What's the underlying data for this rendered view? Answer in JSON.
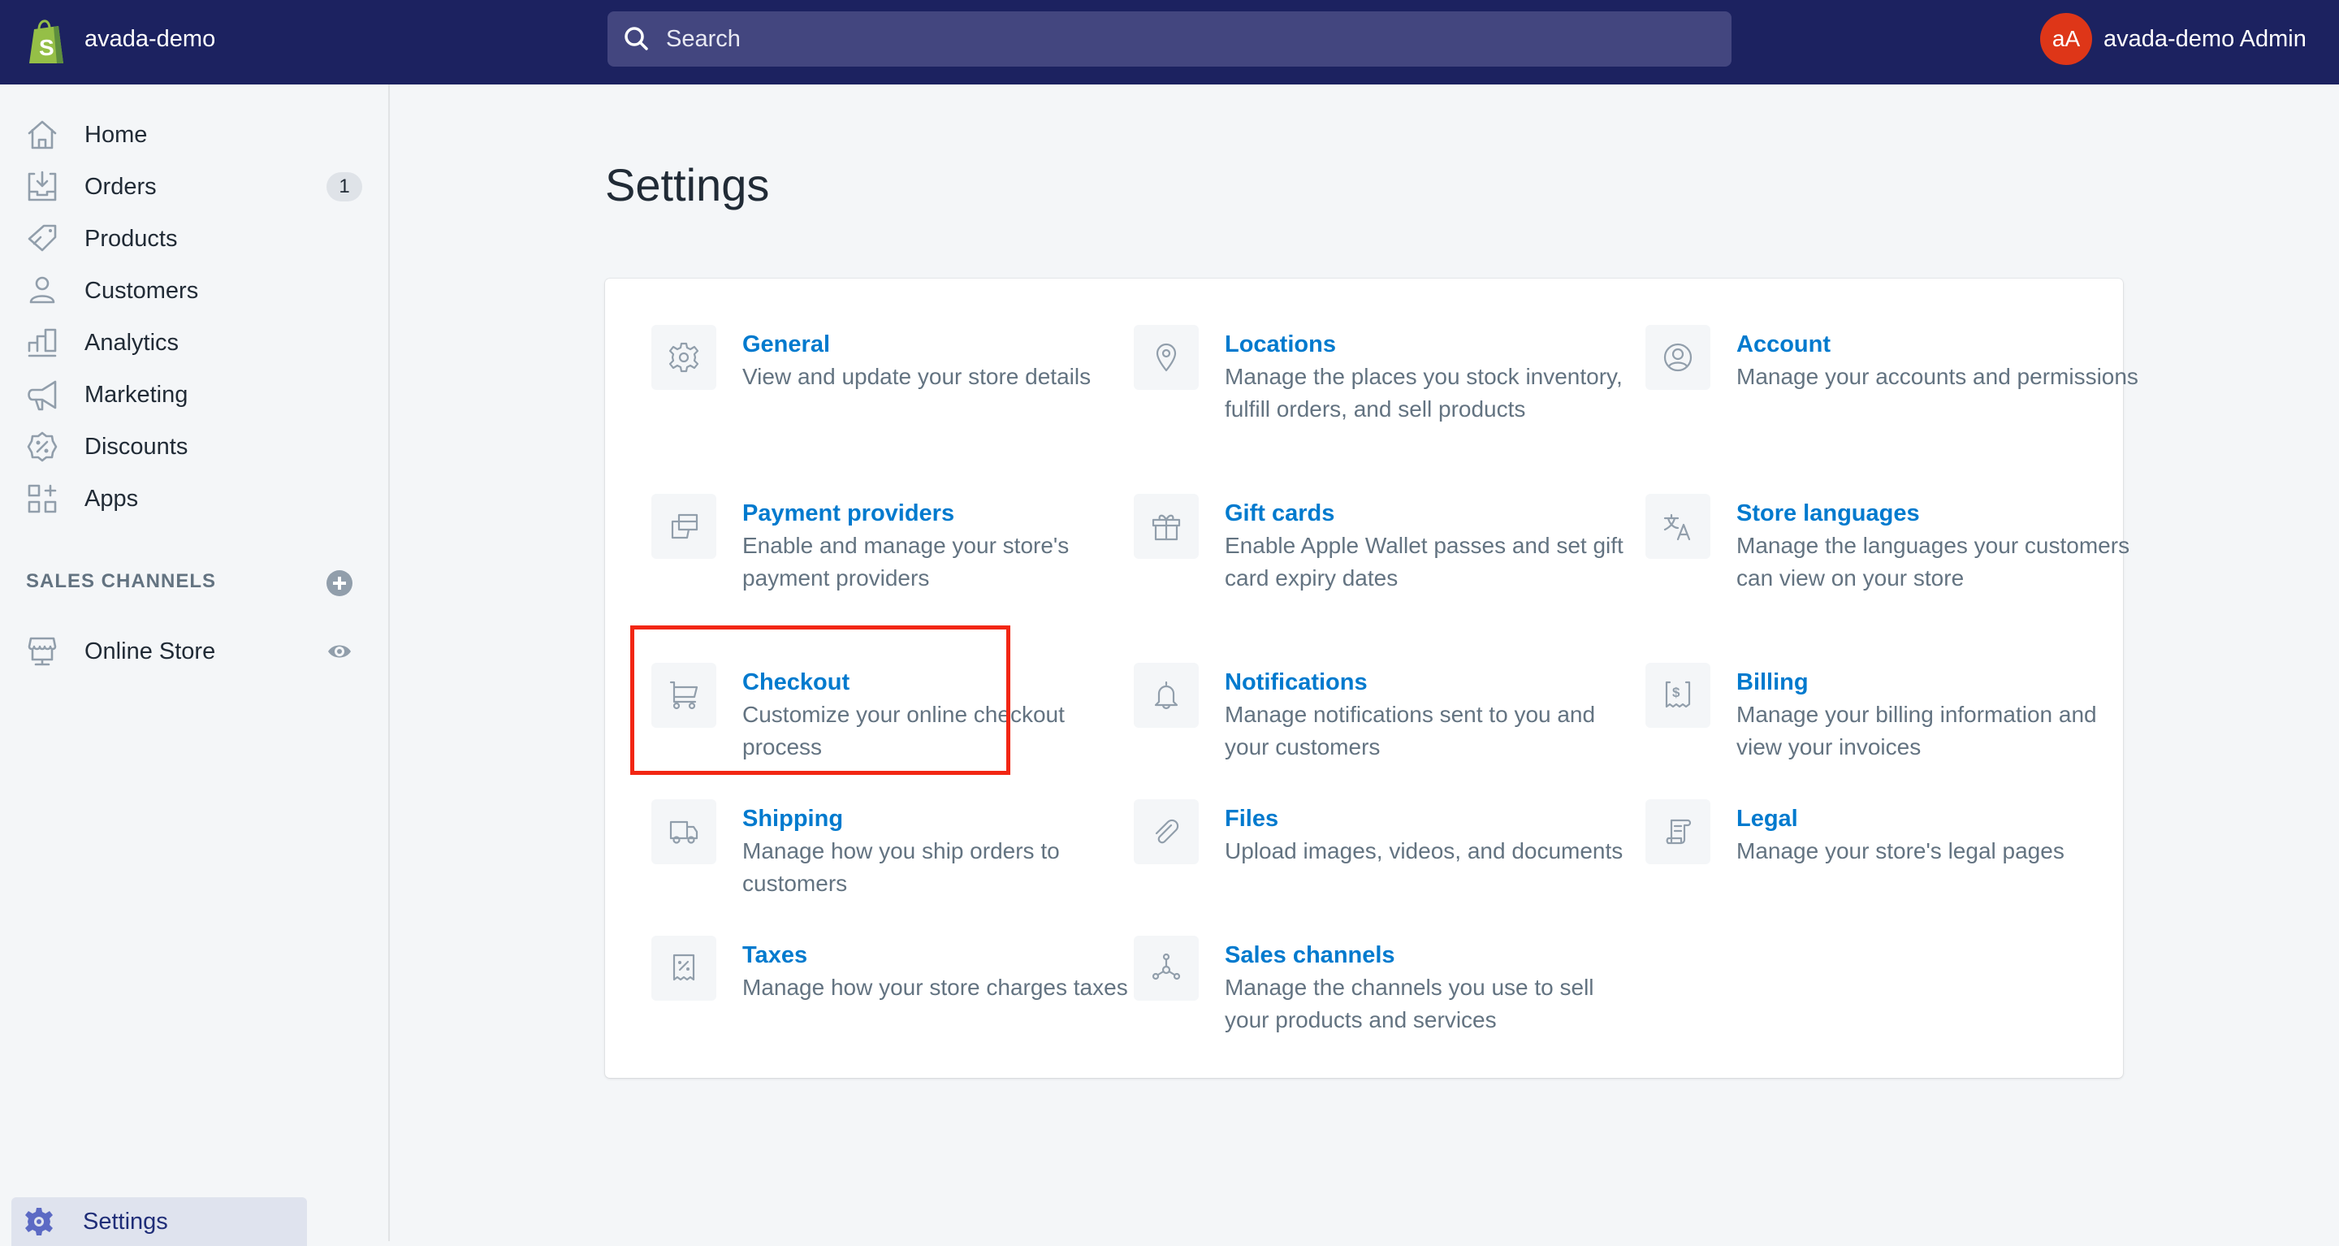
{
  "topbar": {
    "store_name": "avada-demo",
    "search_placeholder": "Search",
    "avatar_initials": "aA",
    "user_name": "avada-demo Admin"
  },
  "sidebar": {
    "items": [
      {
        "label": "Home",
        "icon": "home-icon"
      },
      {
        "label": "Orders",
        "icon": "orders-icon",
        "badge": "1"
      },
      {
        "label": "Products",
        "icon": "tag-icon"
      },
      {
        "label": "Customers",
        "icon": "person-icon"
      },
      {
        "label": "Analytics",
        "icon": "bar-chart-icon"
      },
      {
        "label": "Marketing",
        "icon": "megaphone-icon"
      },
      {
        "label": "Discounts",
        "icon": "discount-icon"
      },
      {
        "label": "Apps",
        "icon": "apps-icon"
      }
    ],
    "sales_channels_heading": "SALES CHANNELS",
    "channels": [
      {
        "label": "Online Store",
        "icon": "store-icon"
      }
    ],
    "settings_label": "Settings"
  },
  "main": {
    "title": "Settings",
    "settings": [
      {
        "title": "General",
        "desc": "View and update your store details",
        "icon": "gear-icon"
      },
      {
        "title": "Locations",
        "desc": "Manage the places you stock inventory, fulfill orders, and sell products",
        "icon": "location-pin-icon"
      },
      {
        "title": "Account",
        "desc": "Manage your accounts and permissions",
        "icon": "account-icon"
      },
      {
        "title": "Payment providers",
        "desc": "Enable and manage your store's payment providers",
        "icon": "payment-icon"
      },
      {
        "title": "Gift cards",
        "desc": "Enable Apple Wallet passes and set gift card expiry dates",
        "icon": "gift-icon"
      },
      {
        "title": "Store languages",
        "desc": "Manage the languages your customers can view on your store",
        "icon": "translate-icon"
      },
      {
        "title": "Checkout",
        "desc": "Customize your online checkout process",
        "icon": "cart-icon"
      },
      {
        "title": "Notifications",
        "desc": "Manage notifications sent to you and your customers",
        "icon": "bell-icon"
      },
      {
        "title": "Billing",
        "desc": "Manage your billing information and view your invoices",
        "icon": "billing-icon"
      },
      {
        "title": "Shipping",
        "desc": "Manage how you ship orders to customers",
        "icon": "truck-icon"
      },
      {
        "title": "Files",
        "desc": "Upload images, videos, and documents",
        "icon": "paperclip-icon"
      },
      {
        "title": "Legal",
        "desc": "Manage your store's legal pages",
        "icon": "legal-scroll-icon"
      },
      {
        "title": "Taxes",
        "desc": "Manage how your store charges taxes",
        "icon": "tax-receipt-icon"
      },
      {
        "title": "Sales channels",
        "desc": "Manage the channels you use to sell your products and services",
        "icon": "sales-channels-icon"
      }
    ]
  },
  "colors": {
    "topbar": "#1c2260",
    "link": "#007ace",
    "highlight": "#f22613",
    "avatar": "#de3618"
  }
}
